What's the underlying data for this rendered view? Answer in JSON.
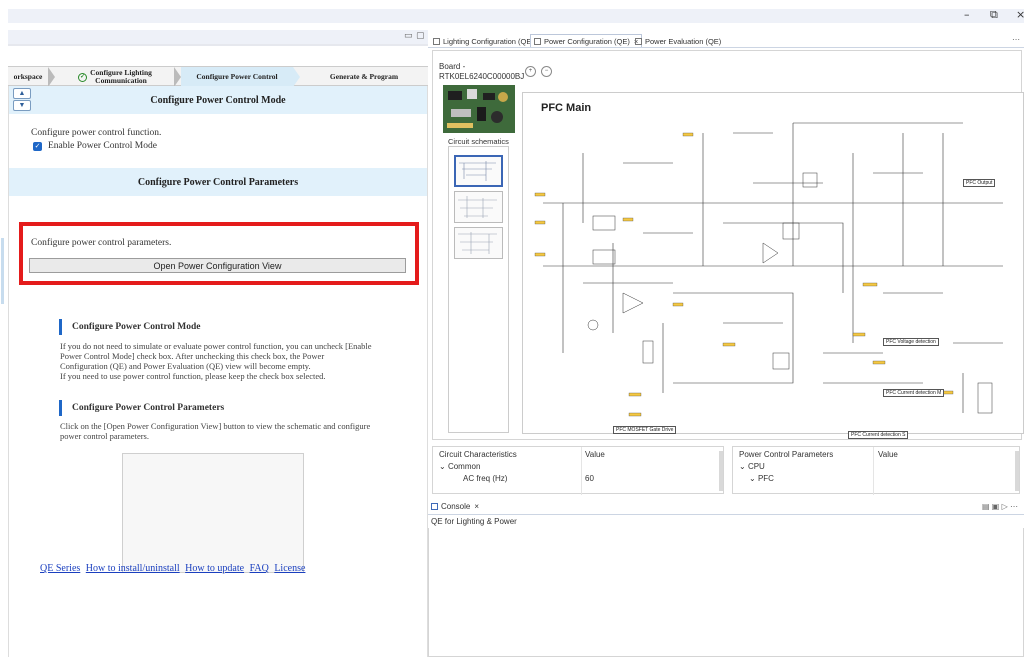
{
  "window": {
    "minimize": "–",
    "maximize": "⧉",
    "close": "×"
  },
  "left_panel": {
    "steps": [
      {
        "label": "orkspace"
      },
      {
        "label": "Configure Lighting Communication",
        "line1": "Configure Lighting",
        "line2": "Communication"
      },
      {
        "label": "Configure Power Control"
      },
      {
        "label": "Generate & Program"
      }
    ],
    "mode_section": {
      "title": "Configure Power Control Mode",
      "description": "Configure power control function.",
      "checkbox_label": "Enable Power Control Mode",
      "checked": true
    },
    "params_section": {
      "title": "Configure Power Control Parameters",
      "description": "Configure power control parameters.",
      "button_label": "Open Power Configuration View"
    },
    "help": [
      {
        "title": "Configure Power Control Mode",
        "lines": [
          "If you do not need to simulate or evaluate power control function, you can uncheck [Enable",
          "Power Control Mode] check box. After unchecking this check box, the Power",
          "Configuration (QE) and Power Evaluation (QE) view will become empty.",
          "If you need to use power control function, please keep the check box selected."
        ]
      },
      {
        "title": "Configure Power Control Parameters",
        "lines": [
          "Click on the [Open Power Configuration View] button to view the schematic and configure",
          "power control parameters."
        ]
      }
    ],
    "links": [
      "QE Series",
      "How to install/uninstall",
      "How to update",
      "FAQ",
      "License"
    ]
  },
  "right_panel": {
    "tabs": [
      {
        "label": "Lighting Configuration (QE)",
        "active": false
      },
      {
        "label": "Power Configuration (QE)",
        "active": true,
        "close": "×"
      },
      {
        "label": "Power Evaluation (QE)",
        "active": false
      }
    ],
    "board_label": "Board -",
    "board_name": "RTK0EL6240C00000BJ",
    "circuit_schematics_label": "Circuit schematics",
    "schematic": {
      "title": "PFC Main",
      "labels": [
        "PFC Output",
        "PFC Voltage detection",
        "PFC Current detection M",
        "PFC Current detection S",
        "PFC MOSFET Gate Drive"
      ]
    },
    "circuit_characteristics": {
      "header_name": "Circuit Characteristics",
      "header_value": "Value",
      "group": "Common",
      "rows": [
        {
          "name": "AC freq (Hz)",
          "value": "60"
        }
      ]
    },
    "power_control_parameters": {
      "header_name": "Power Control Parameters",
      "header_value": "Value",
      "group": "CPU",
      "subgroup": "PFC"
    },
    "console": {
      "tab_label": "Console",
      "close": "×",
      "text": "QE for Lighting & Power"
    }
  }
}
